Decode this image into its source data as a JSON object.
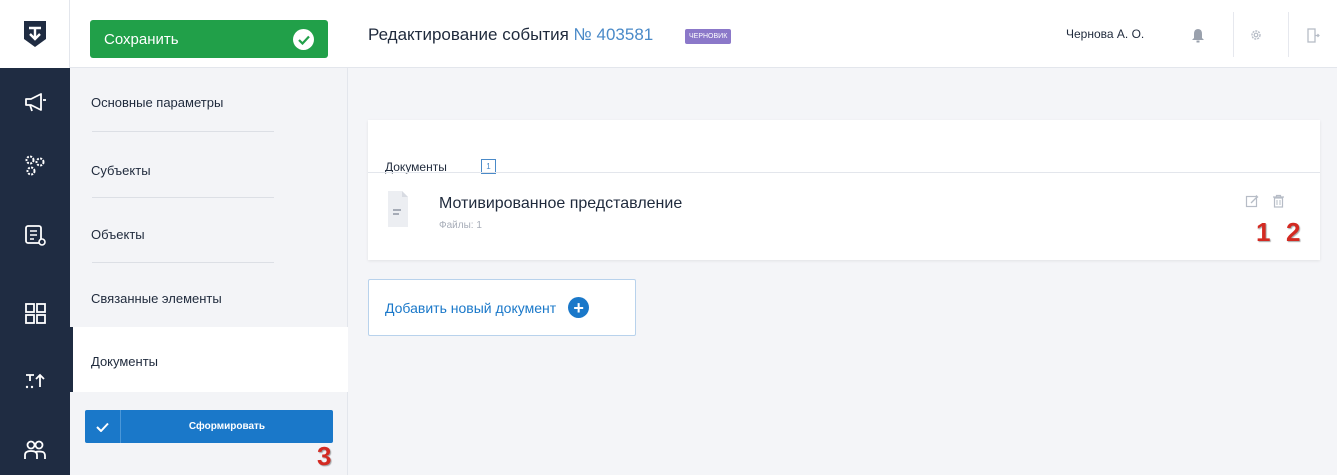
{
  "save_button": {
    "label": "Сохранить"
  },
  "header": {
    "title": "Редактирование события",
    "event_number": "№ 403581",
    "status_badge": "ЧЕРНОВИК",
    "user_name": "Чернова А. О."
  },
  "nav": {
    "items": [
      {
        "label": "Основные параметры"
      },
      {
        "label": "Субъекты"
      },
      {
        "label": "Объекты"
      },
      {
        "label": "Связанные элементы"
      },
      {
        "label": "Документы",
        "active": true
      }
    ],
    "form_button_label": "Сформировать"
  },
  "documents": {
    "heading": "Документы",
    "count": "1",
    "items": [
      {
        "name": "Мотивированное представление",
        "files_label": "Файлы: 1"
      }
    ],
    "add_label": "Добавить новый документ"
  },
  "markers": {
    "edit": "1",
    "delete": "2",
    "form": "3"
  },
  "colors": {
    "rail": "#1f2c42",
    "save": "#21a049",
    "primary": "#1a78c9",
    "badge": "#8b78c9",
    "marker": "#d32a22"
  },
  "rail_icons": [
    "megaphone-icon",
    "gears-icon",
    "report-icon",
    "dashboard-icon",
    "transfer-icon",
    "users-icon"
  ]
}
